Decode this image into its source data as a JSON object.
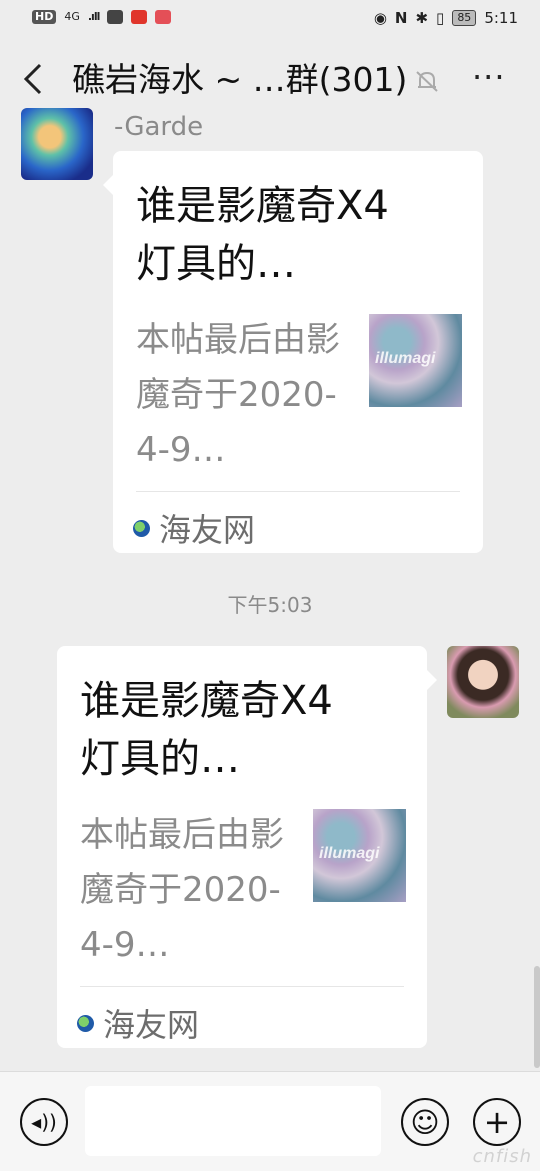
{
  "status_bar": {
    "network_badge": "HD",
    "network_type": "4G",
    "signal": ".ıll",
    "time": "5:11",
    "battery": "85",
    "icons": [
      "eye-icon",
      "nfc-icon",
      "bluetooth-icon",
      "vibrate-icon"
    ]
  },
  "header": {
    "back_icon": "back-arrow-icon",
    "title": "礁岩海水 ~ …群(301)",
    "mute_icon": "bell-muted-icon",
    "more_icon": "more-icon",
    "more_label": "···"
  },
  "messages": [
    {
      "side": "left",
      "sender": "-Garde",
      "card": {
        "title": "谁是影魔奇X4灯具的…",
        "desc": "本帖最后由影魔奇于2020-4-9…",
        "thumb_text": "illumagi",
        "source": "海友网"
      }
    },
    {
      "timestamp": "下午5:03"
    },
    {
      "side": "right",
      "card": {
        "title": "谁是影魔奇X4灯具的…",
        "desc": "本帖最后由影魔奇于2020-4-9…",
        "thumb_text": "illumagi",
        "source": "海友网"
      }
    }
  ],
  "input_bar": {
    "voice_icon": "voice-icon",
    "voice_glyph": "◂))",
    "emoji_icon": "emoji-icon",
    "emoji_glyph": "☺",
    "plus_icon": "plus-icon",
    "plus_glyph": "+",
    "watermark": "cnfish"
  }
}
